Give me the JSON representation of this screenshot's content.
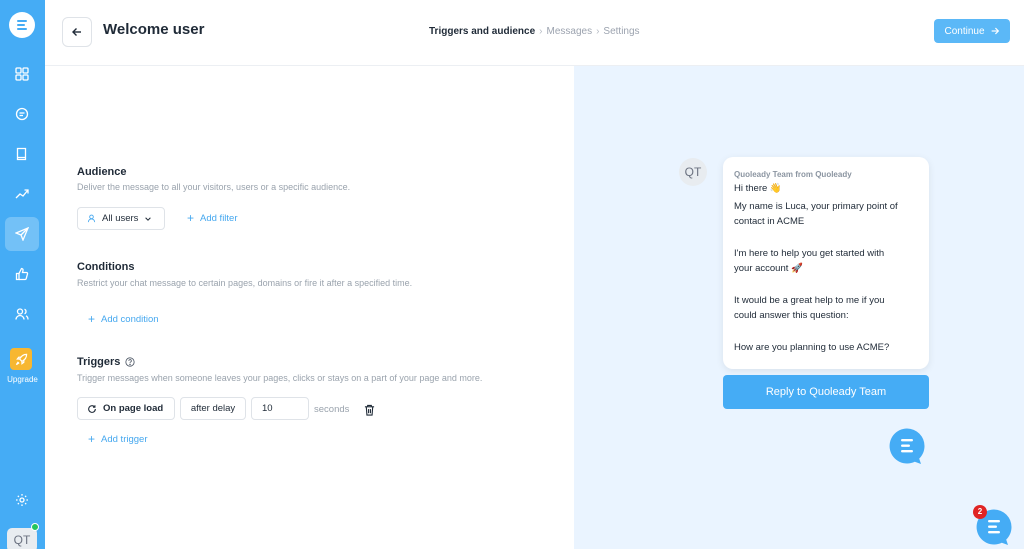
{
  "header": {
    "title": "Welcome user",
    "steps": [
      {
        "label": "Triggers and audience",
        "active": true
      },
      {
        "label": "Messages",
        "active": false
      },
      {
        "label": "Settings",
        "active": false
      }
    ],
    "continue_label": "Continue"
  },
  "sidebar": {
    "upgrade_label": "Upgrade",
    "avatar_initials": "QT",
    "items": [
      "grid-icon",
      "chat-icon",
      "book-icon",
      "trending-icon",
      "send-icon",
      "thumbs-up-icon",
      "users-icon"
    ]
  },
  "audience": {
    "title": "Audience",
    "description": "Deliver the message to all your visitors, users or a specific audience.",
    "selected": "All users",
    "add_filter": "Add filter"
  },
  "conditions": {
    "title": "Conditions",
    "description": "Restrict your chat message to certain pages, domains or fire it after a specified time.",
    "add_condition": "Add condition"
  },
  "triggers": {
    "title": "Triggers",
    "description": "Trigger messages when someone leaves your pages, clicks or stays on a part of your page and more.",
    "event": "On page load",
    "timing": "after delay",
    "delay_value": "10",
    "unit": "seconds",
    "add_trigger": "Add trigger"
  },
  "preview": {
    "avatar_initials": "QT",
    "from": "Quoleady Team from Quoleady",
    "lines": [
      "Hi there 👋",
      "My name is Luca, your primary point of",
      "contact in ACME",
      "I'm here to help you get started with",
      "your account 🚀",
      "It would be a great help to me if you",
      "could answer this question:",
      "How are you planning to use ACME?"
    ],
    "reply_label": "Reply to Quoleady Team",
    "notification_count": "2"
  },
  "colors": {
    "brand": "#45acf5",
    "preview_bg": "#eaf4ff",
    "link": "#46a8ef",
    "upgrade": "#f7b731",
    "badge": "#e02424"
  }
}
